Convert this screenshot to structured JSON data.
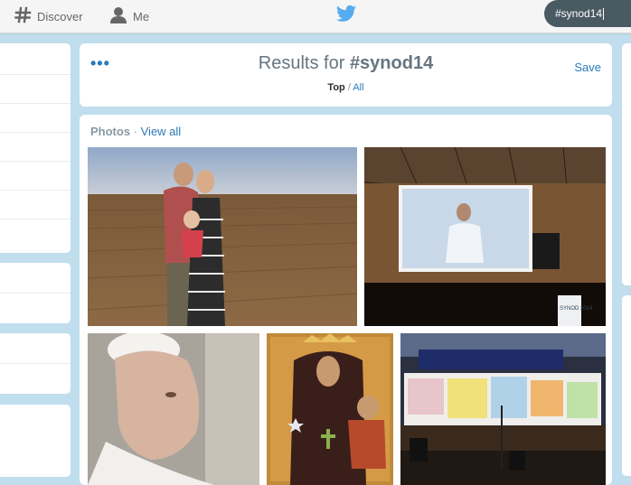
{
  "nav": {
    "discover_label": "Discover",
    "me_label": "Me"
  },
  "search": {
    "value": "#synod14"
  },
  "results": {
    "prefix": "Results for ",
    "query": "#synod14",
    "filter_top": "Top",
    "filter_sep": " / ",
    "filter_all": "All",
    "save_label": "Save",
    "more_icon": "more-dots-icon"
  },
  "photos": {
    "label": "Photos",
    "separator": " · ",
    "view_all": "View all",
    "items": [
      "family-in-field-photo",
      "speaker-on-projection-screen-photo",
      "pope-portrait-photo",
      "madonna-icon-painting-photo",
      "stage-with-banners-photo"
    ],
    "screen_banner": "SYNOD 2014"
  },
  "colors": {
    "link": "#2b7bb9",
    "background": "#c0deed",
    "search_bg": "#4a5a63",
    "muted": "#66757f"
  }
}
